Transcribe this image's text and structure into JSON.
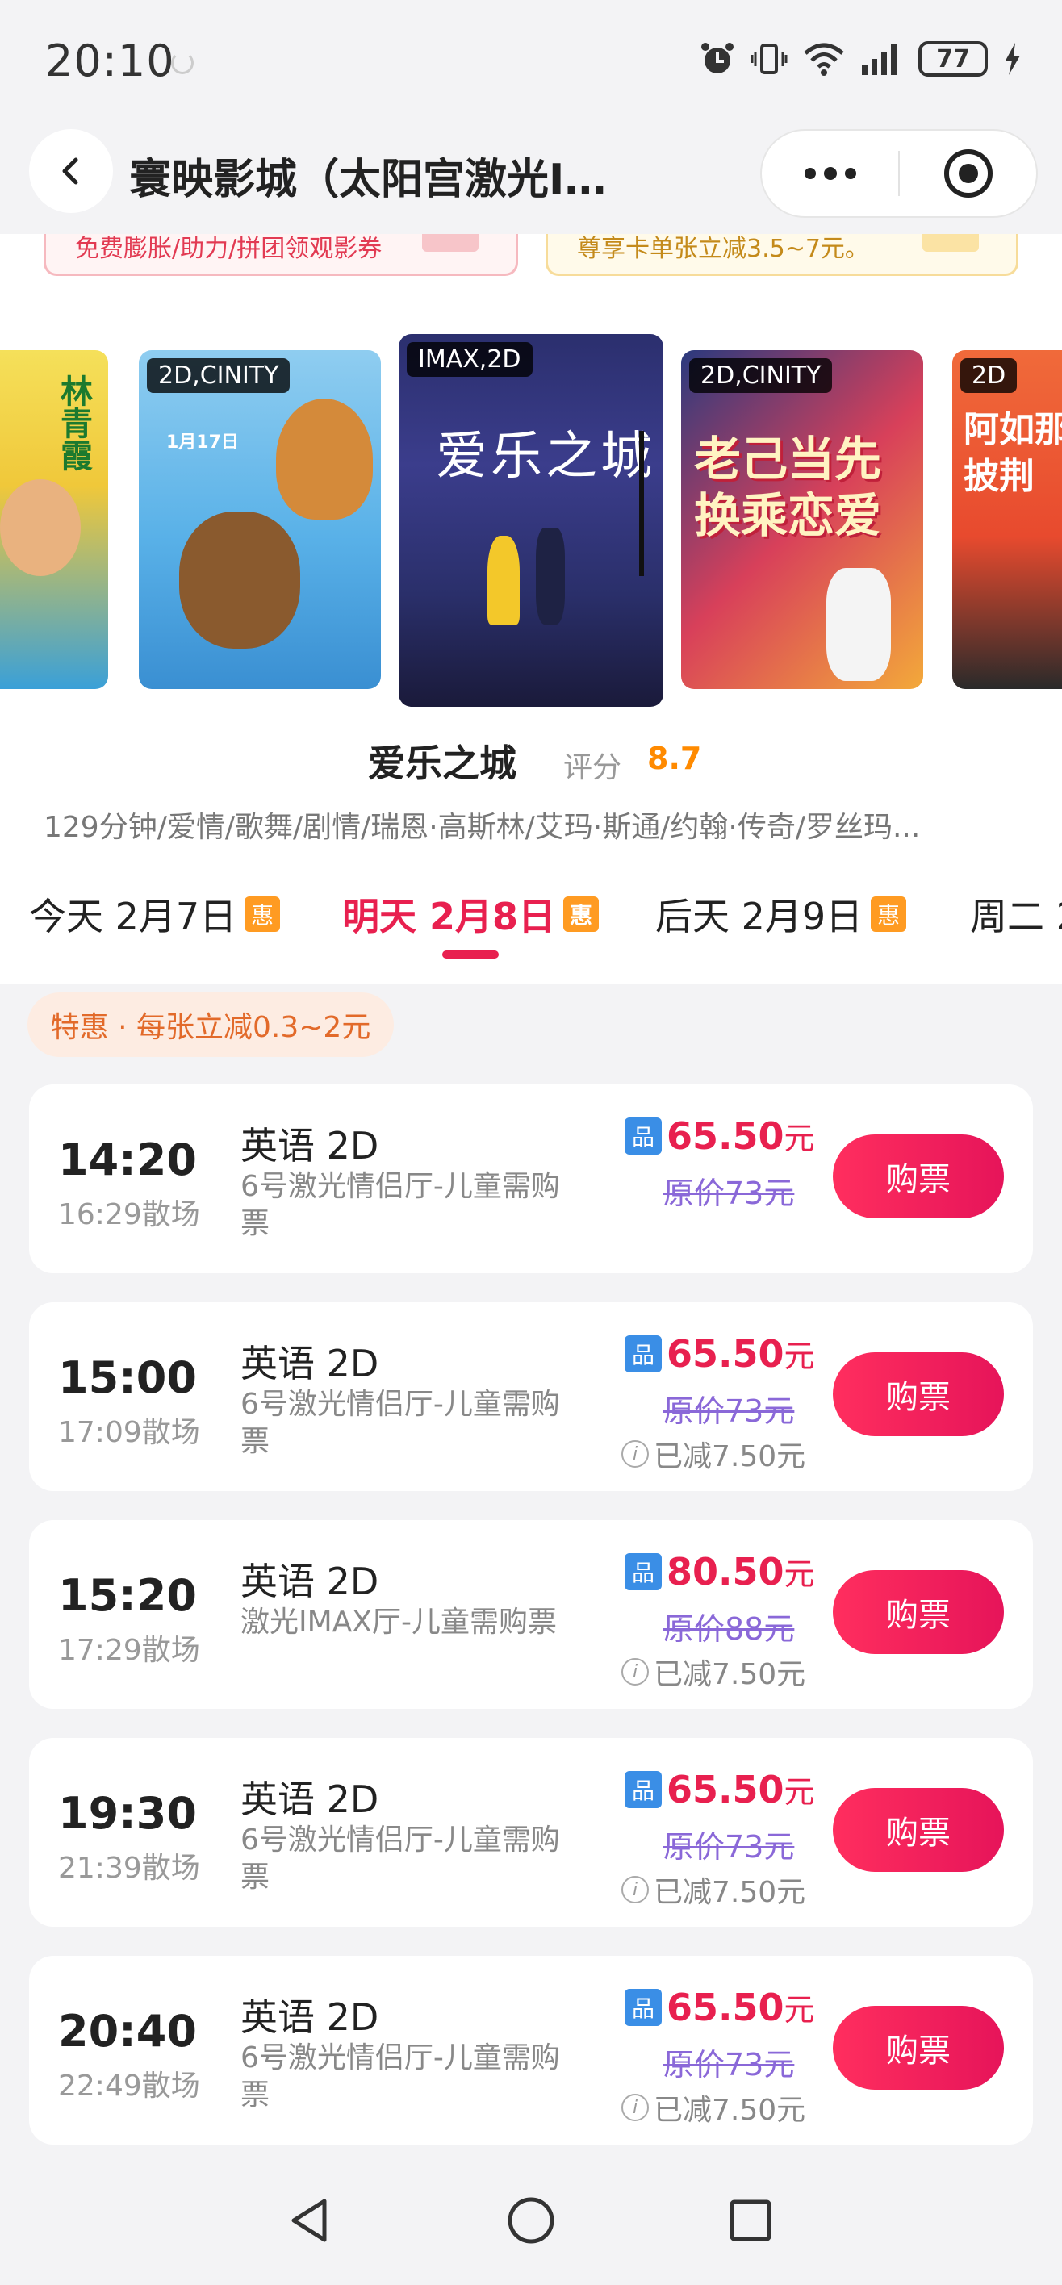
{
  "status_bar": {
    "time": "20:10",
    "battery": "77"
  },
  "header": {
    "title": "寰映影城（太阳宫激光I…"
  },
  "promos": {
    "left": "免费膨胀/助力/拼团领观影券",
    "right": "尊享卡单张立减3.5~7元。"
  },
  "posters": [
    {
      "badge": "",
      "text": "林青霞"
    },
    {
      "badge": "2D,CINITY",
      "text": "1月17日"
    },
    {
      "badge": "IMAX,2D",
      "text": "爱乐之城"
    },
    {
      "badge": "2D,CINITY",
      "text": "老己当先 换乘恋爱"
    },
    {
      "badge": "2D",
      "text": "阿如那 披荆"
    }
  ],
  "movie": {
    "title": "爱乐之城",
    "rating_label": "评分",
    "rating": "8.7",
    "meta": "129分钟/爱情/歌舞/剧情/瑞恩·高斯林/艾玛·斯通/约翰·传奇/罗丝玛..."
  },
  "dates": [
    {
      "label": "今天 2月7日",
      "tag": "惠"
    },
    {
      "label": "明天 2月8日",
      "tag": "惠"
    },
    {
      "label": "后天 2月9日",
      "tag": "惠"
    },
    {
      "label": "周二 2",
      "tag": ""
    }
  ],
  "discount_pill": "特惠 · 每张立减0.3~2元",
  "showtimes": [
    {
      "start": "14:20",
      "end": "16:29散场",
      "lang": "英语 2D",
      "hall": "6号激光情侣厅-儿童需购票",
      "pin": "品",
      "price": "65.50",
      "unit": "元",
      "orig": "原价73元",
      "saved": "",
      "buy": "购票"
    },
    {
      "start": "15:00",
      "end": "17:09散场",
      "lang": "英语 2D",
      "hall": "6号激光情侣厅-儿童需购票",
      "pin": "品",
      "price": "65.50",
      "unit": "元",
      "orig": "原价73元",
      "saved": "已减7.50元",
      "buy": "购票"
    },
    {
      "start": "15:20",
      "end": "17:29散场",
      "lang": "英语 2D",
      "hall": "激光IMAX厅-儿童需购票",
      "pin": "品",
      "price": "80.50",
      "unit": "元",
      "orig": "原价88元",
      "saved": "已减7.50元",
      "buy": "购票"
    },
    {
      "start": "19:30",
      "end": "21:39散场",
      "lang": "英语 2D",
      "hall": "6号激光情侣厅-儿童需购票",
      "pin": "品",
      "price": "65.50",
      "unit": "元",
      "orig": "原价73元",
      "saved": "已减7.50元",
      "buy": "购票"
    },
    {
      "start": "20:40",
      "end": "22:49散场",
      "lang": "英语 2D",
      "hall": "6号激光情侣厅-儿童需购票",
      "pin": "品",
      "price": "65.50",
      "unit": "元",
      "orig": "原价73元",
      "saved": "已减7.50元",
      "buy": "购票"
    }
  ]
}
